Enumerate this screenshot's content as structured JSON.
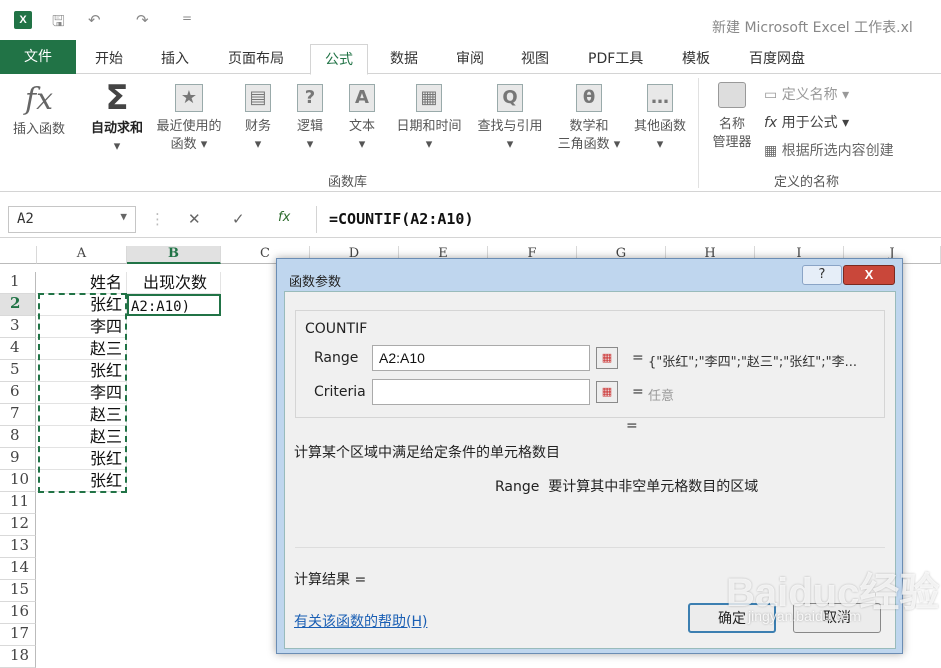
{
  "window": {
    "title": "新建 Microsoft Excel 工作表.xl"
  },
  "quick_access": {
    "save": "🖫",
    "undo": "↶",
    "redo": "↷",
    "more": "="
  },
  "tabs": [
    "文件",
    "开始",
    "插入",
    "页面布局",
    "公式",
    "数据",
    "审阅",
    "视图",
    "PDF工具",
    "模板",
    "百度网盘"
  ],
  "active_tab": "公式",
  "ribbon": {
    "insert_function": {
      "icon": "fx",
      "label": "插入函数"
    },
    "autosum": {
      "icon": "Σ",
      "label": "自动求和",
      "dropdown": "▾"
    },
    "recent": {
      "icon": "★",
      "label1": "最近使用的",
      "label2": "函数 ▾"
    },
    "financial": {
      "icon": "▤",
      "label": "财务",
      "dropdown": "▾"
    },
    "logical": {
      "icon": "?",
      "label": "逻辑",
      "dropdown": "▾"
    },
    "text": {
      "icon": "A",
      "label": "文本",
      "dropdown": "▾"
    },
    "datetime": {
      "icon": "▦",
      "label": "日期和时间",
      "dropdown": "▾"
    },
    "lookup": {
      "icon": "Q",
      "label": "查找与引用",
      "dropdown": "▾"
    },
    "math": {
      "icon": "θ",
      "label1": "数学和",
      "label2": "三角函数 ▾"
    },
    "other": {
      "icon": "…",
      "label": "其他函数",
      "dropdown": "▾"
    },
    "function_library_label": "函数库",
    "name_manager": {
      "label1": "名称",
      "label2": "管理器"
    },
    "define_name": "定义名称",
    "use_in_formula": "用于公式",
    "create_from_selection": "根据所选内容创建",
    "defined_names_label": "定义的名称"
  },
  "formula_bar": {
    "name_box": "A2",
    "cancel": "✕",
    "enter": "✓",
    "fx": "fx",
    "formula": "=COUNTIF(A2:A10)"
  },
  "sheet": {
    "columns": [
      "A",
      "B",
      "C",
      "D",
      "E",
      "F",
      "G",
      "H",
      "I",
      "J"
    ],
    "rows": [
      "1",
      "2",
      "3",
      "4",
      "5",
      "6",
      "7",
      "8",
      "9",
      "10",
      "11",
      "12",
      "13",
      "14",
      "15",
      "16",
      "17",
      "18"
    ],
    "a_values": [
      "姓名",
      "张红",
      "李四",
      "赵三",
      "张红",
      "李四",
      "赵三",
      "赵三",
      "张红",
      "张红"
    ],
    "b1": "出现次数",
    "b2": "A2:A10)",
    "selected_col": "B",
    "selected_row": "2"
  },
  "dialog": {
    "title": "函数参数",
    "help_btn": "?",
    "close_btn": "X",
    "function_name": "COUNTIF",
    "args": [
      {
        "label": "Range",
        "value": "A2:A10",
        "eq": "=",
        "result": "{\"张红\";\"李四\";\"赵三\";\"张红\";\"李..."
      },
      {
        "label": "Criteria",
        "value": "",
        "eq": "=",
        "result": "任意"
      }
    ],
    "result_eq": "=",
    "description": "计算某个区域中满足给定条件的单元格数目",
    "arg_description_name": "Range",
    "arg_description": "要计算其中非空单元格数目的区域",
    "calc_result": "计算结果 =",
    "help_link": "有关该函数的帮助(H)",
    "ok": "确定",
    "cancel": "取消"
  },
  "watermark": {
    "main": "Baiduc经验",
    "sub": "jingyan.baidu.com"
  }
}
